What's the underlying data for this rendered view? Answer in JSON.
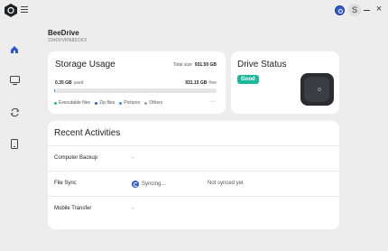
{
  "titlebar": {
    "avatar_initial": "S"
  },
  "sidebar": {
    "items": [
      {
        "name": "home",
        "active": true
      },
      {
        "name": "computer-backup"
      },
      {
        "name": "sync"
      },
      {
        "name": "mobile"
      }
    ]
  },
  "device": {
    "name": "BeeDrive",
    "serial": "2340VVRN85CKX"
  },
  "storage": {
    "title": "Storage Usage",
    "total_label": "Total size",
    "total_value": "931.50 GB",
    "used_value": "0.35 GB",
    "used_label": "used",
    "free_value": "931.15 GB",
    "free_label": "free",
    "used_fraction": 0.0004,
    "legend": [
      {
        "label": "Executable files",
        "color": "#1db7a0"
      },
      {
        "label": "Zip files",
        "color": "#2f5bd3"
      },
      {
        "label": "Pictures",
        "color": "#3a8fd8"
      },
      {
        "label": "Others",
        "color": "#9aa0a6"
      }
    ],
    "more_label": "···"
  },
  "drive_status": {
    "title": "Drive Status",
    "status": "Good",
    "status_color": "#1db7a0"
  },
  "activities": {
    "title": "Recent Activities",
    "rows": [
      {
        "label": "Computer Backup",
        "status": "-",
        "extra": ""
      },
      {
        "label": "File Sync",
        "status": "Syncing...",
        "extra": "Not synced yet"
      },
      {
        "label": "Mobile Transfer",
        "status": "-",
        "extra": ""
      }
    ]
  }
}
